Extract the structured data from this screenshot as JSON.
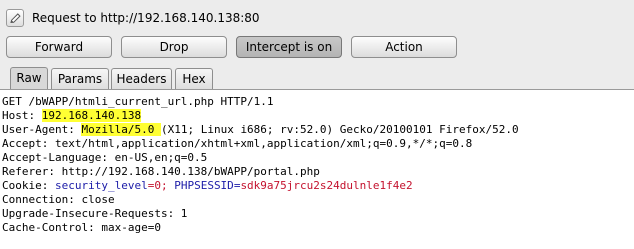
{
  "intercept": {
    "request_label": "Request to http://192.168.140.138:80",
    "icon": "pencil-icon"
  },
  "toolbar": {
    "forward_label": "Forward",
    "drop_label": "Drop",
    "intercept_label": "Intercept is on",
    "action_label": "Action"
  },
  "tabs": [
    {
      "label": "Raw",
      "active": true
    },
    {
      "label": "Params",
      "active": false
    },
    {
      "label": "Headers",
      "active": false
    },
    {
      "label": "Hex",
      "active": false
    }
  ],
  "request": {
    "request_line": "GET /bWAPP/htmli_current_url.php HTTP/1.1",
    "host_name": "Host: ",
    "host_value": "192.168.140.138",
    "ua_name": "User-Agent: ",
    "ua_value_highlight": "Mozilla/5.0 ",
    "ua_value_rest": "(X11; Linux i686; rv:52.0) Gecko/20100101 Firefox/52.0",
    "accept": "Accept: text/html,application/xhtml+xml,application/xml;q=0.9,*/*;q=0.8",
    "accept_language": "Accept-Language: en-US,en;q=0.5",
    "referer": "Referer: http://192.168.140.138/bWAPP/portal.php",
    "cookie_name": "Cookie: ",
    "cookie_key1": "security_level",
    "cookie_val1": "=0; ",
    "cookie_key2": "PHPSESSID",
    "cookie_eq2": "=",
    "cookie_val2": "sdk9a75jrcu2s24dulnle1f4e2",
    "connection": "Connection: close",
    "upgrade": "Upgrade-Insecure-Requests: 1",
    "cache_control": "Cache-Control: max-age=0"
  },
  "colors": {
    "highlight": "#ffff33",
    "cookie_key": "#1c1ca8",
    "cookie_value": "#c4122e",
    "panel_background": "#ececec"
  }
}
